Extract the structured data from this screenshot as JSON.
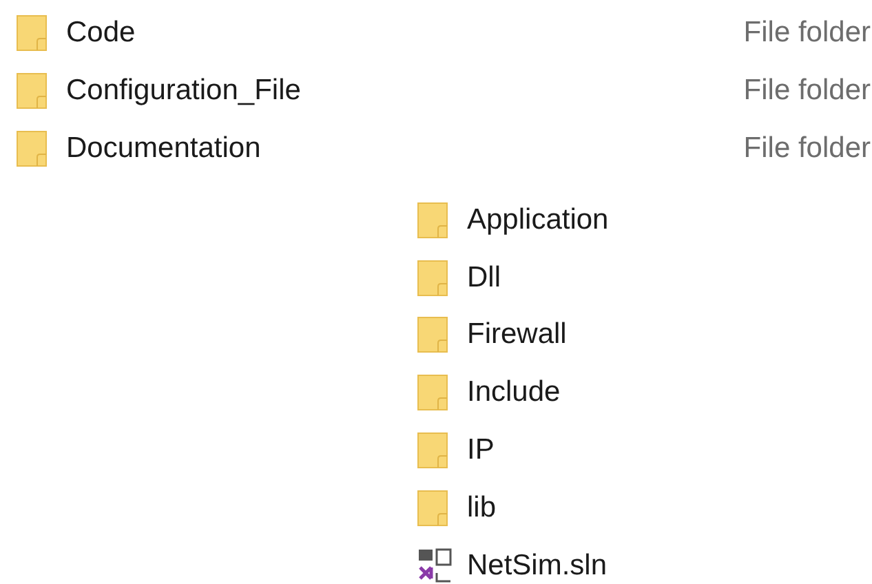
{
  "top_list": [
    {
      "name": "Code",
      "type": "File folder",
      "kind": "folder"
    },
    {
      "name": "Configuration_File",
      "type": "File folder",
      "kind": "folder"
    },
    {
      "name": "Documentation",
      "type": "File folder",
      "kind": "folder"
    }
  ],
  "sub_list": [
    {
      "name": "Application",
      "kind": "folder"
    },
    {
      "name": "Dll",
      "kind": "folder"
    },
    {
      "name": "Firewall",
      "kind": "folder"
    },
    {
      "name": "Include",
      "kind": "folder"
    },
    {
      "name": "IP",
      "kind": "folder"
    },
    {
      "name": "lib",
      "kind": "folder"
    },
    {
      "name": "NetSim.sln",
      "kind": "solution"
    }
  ]
}
